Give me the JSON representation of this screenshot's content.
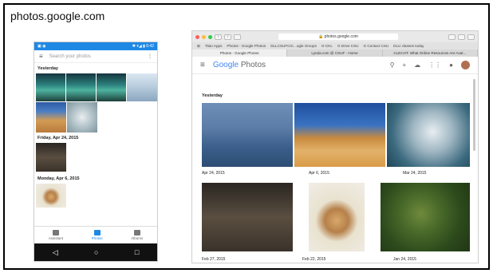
{
  "site_title": "photos.google.com",
  "phone": {
    "status_right": "✱ ▾◢ ▮ 6:42",
    "search_placeholder": "Search your photos",
    "sections": [
      "Yesterday",
      "Friday, Apr 24, 2015",
      "Monday, Apr 6, 2015"
    ],
    "tabs": [
      {
        "label": "Assistant",
        "badge": "1"
      },
      {
        "label": "Photos"
      },
      {
        "label": "Albums"
      }
    ],
    "nav": [
      "◁",
      "○",
      "□"
    ]
  },
  "browser": {
    "url": "photos.google.com",
    "bookmarks": [
      "Titan Apps",
      "Photos - Google Photos",
      "DLLCSUFCIC...ogle Groups",
      "G-CKL",
      "G Drive CSU",
      "G Contact CSU",
      "DLU classes today"
    ],
    "tabs": [
      "Photos - Google Photos",
      "Lynda.com @ CSUF - Home",
      "CLECHT: What Online Resources Are Aval..."
    ],
    "logo_google": "Google",
    "logo_photos": "Photos",
    "section": "Yesterday",
    "captions": [
      "Apr 24, 2015",
      "Apr 6, 2015",
      "Mar 24, 2015",
      "Feb 27, 2015",
      "Feb 22, 2015",
      "Jan 24, 2015"
    ]
  }
}
